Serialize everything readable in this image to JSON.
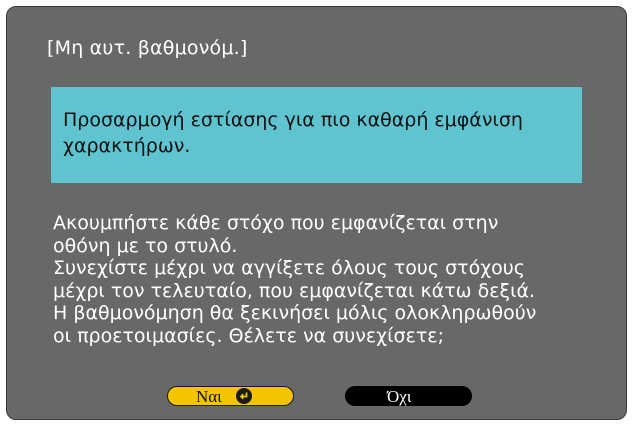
{
  "dialog": {
    "title": "[Μη αυτ. βαθμονόμ.]",
    "focus_message": {
      "lines": [
        "Προσαρμογή εστίασης για πιο καθαρή εμφάνιση",
        "χαρακτήρων."
      ]
    },
    "instructions": {
      "lines": [
        "Ακουμπήστε κάθε στόχο που εμφανίζεται στην",
        "οθόνη με το στυλό.",
        "Συνεχίστε μέχρι να αγγίξετε όλους τους στόχους",
        "μέχρι τον τελευταίο, που εμφανίζεται κάτω δεξιά.",
        "Η βαθμονόμηση θα ξεκινήσει μόλις ολοκληρωθούν",
        "οι προετοιμασίες. Θέλετε να συνεχίσετε;"
      ]
    },
    "buttons": {
      "yes_label": "Ναι",
      "no_label": "Όχι",
      "yes_icon": "enter-icon"
    }
  },
  "colors": {
    "dialog_background": "#686868",
    "focus_box_background": "#5fc4cf",
    "yes_button_background": "#f5c400",
    "no_button_background": "#000000"
  }
}
